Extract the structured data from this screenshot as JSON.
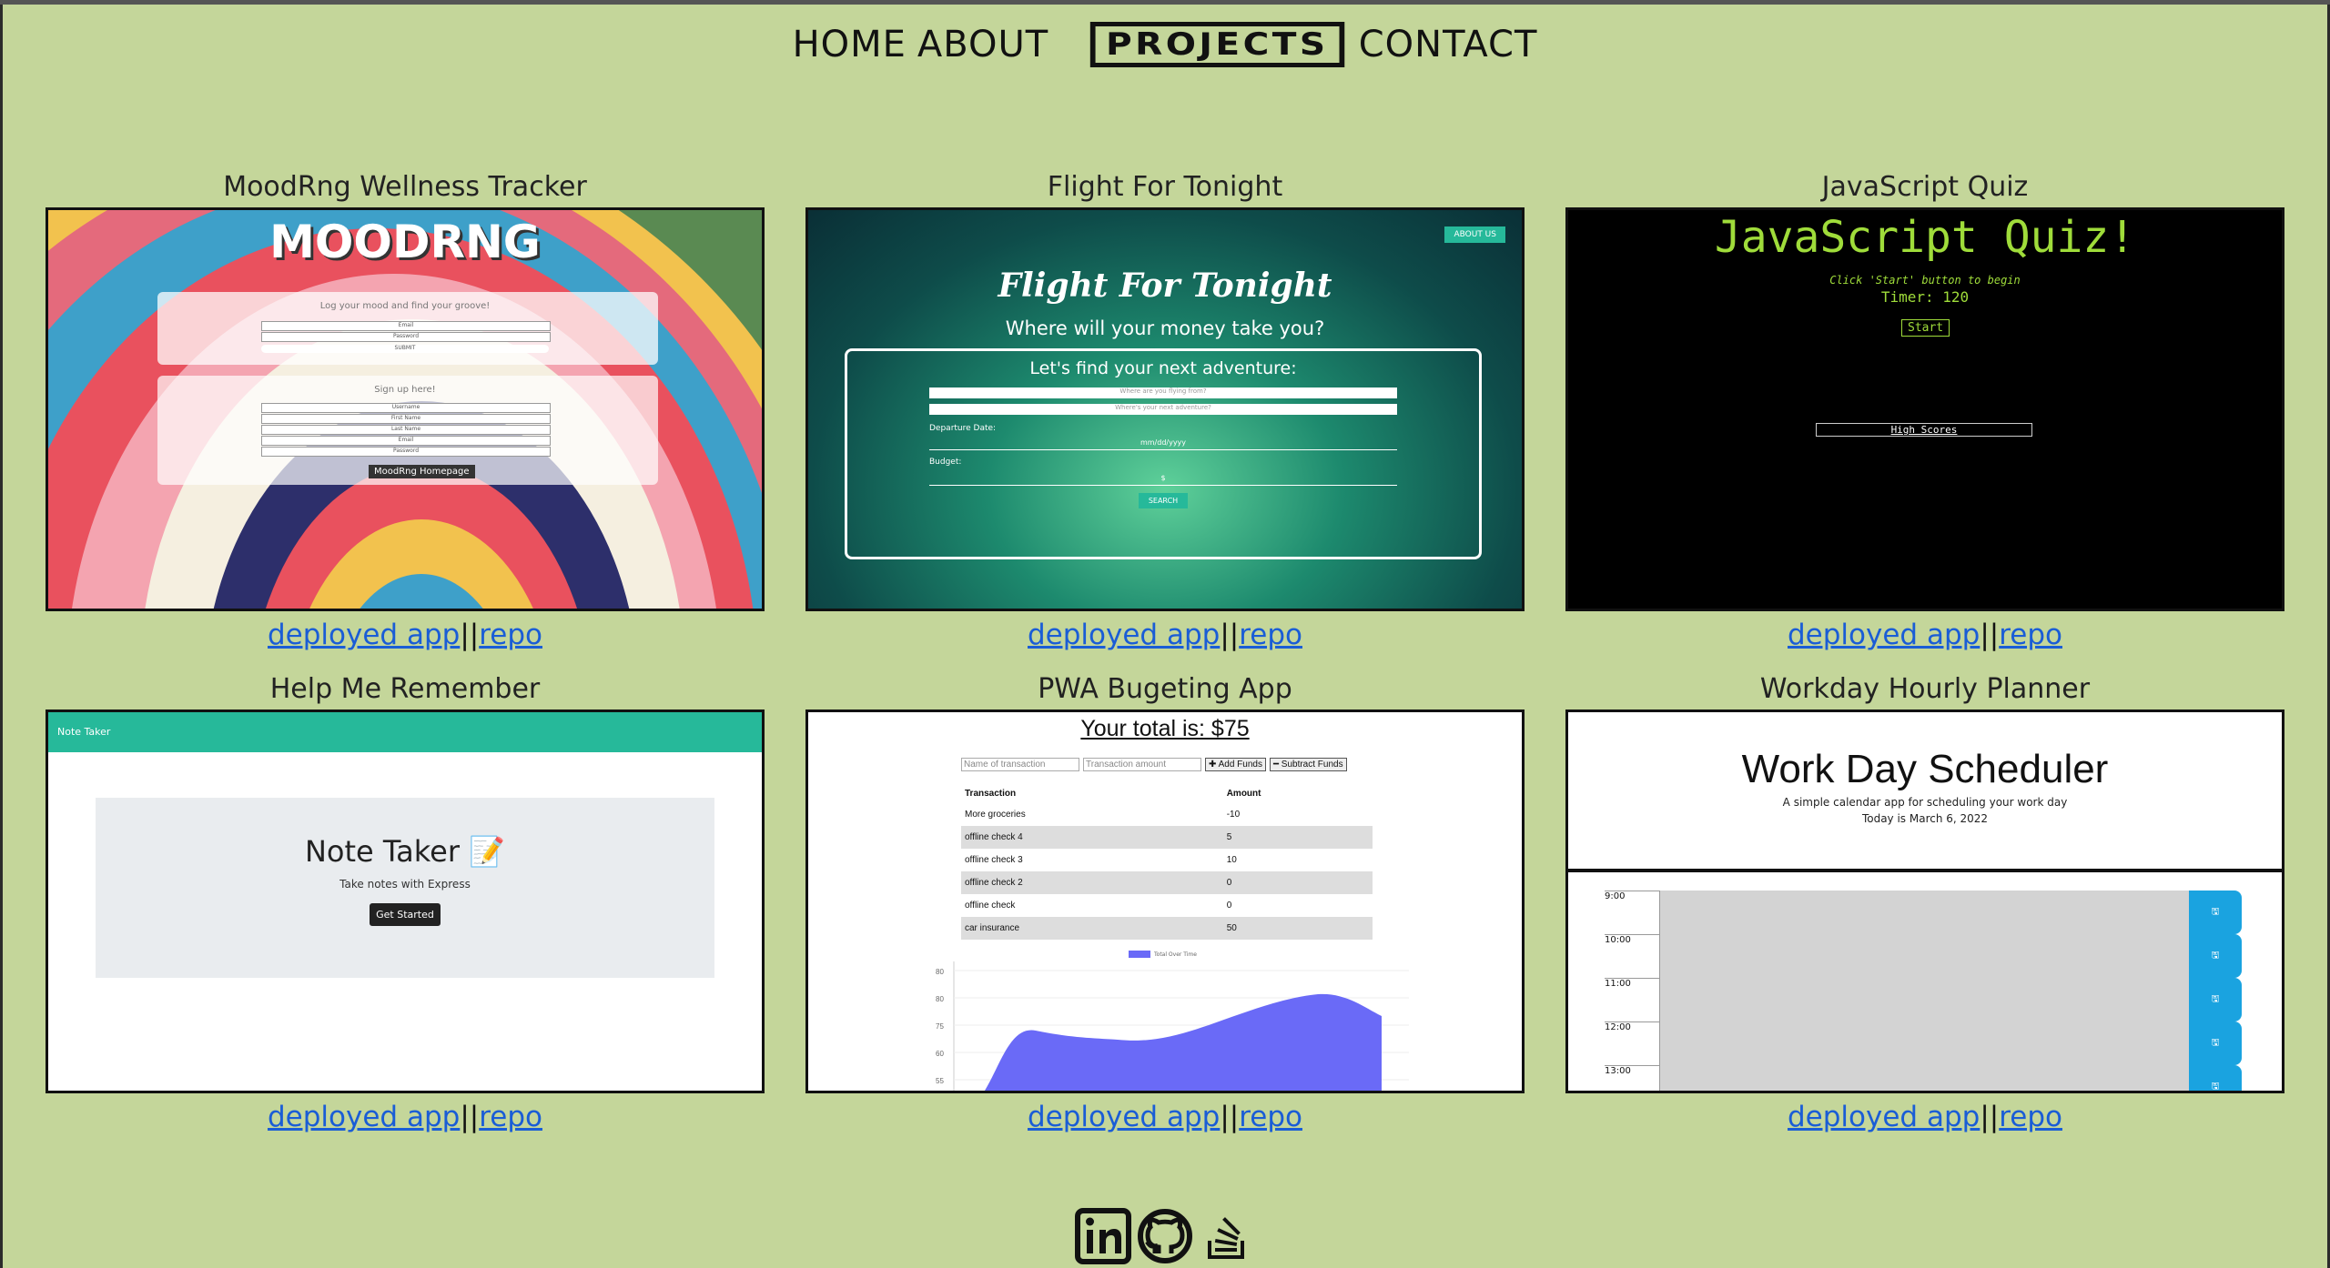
{
  "nav": {
    "items": [
      {
        "label": "HOME"
      },
      {
        "label": "ABOUT"
      },
      {
        "label": "PROJECTS",
        "active": true
      },
      {
        "label": "CONTACT"
      }
    ]
  },
  "projects": [
    {
      "title": "MoodRng Wellness Tracker",
      "deployed": "deployed app",
      "repo": "repo",
      "preview": {
        "logo": "MOODRNG",
        "login_prompt": "Log your mood and find your groove!",
        "email": "Email",
        "password": "Password",
        "submit": "SUBMIT",
        "signup_prompt": "Sign up here!",
        "username": "Username",
        "first": "First Name",
        "last": "Last Name",
        "email2": "Email",
        "password2": "Password",
        "tooltip": "MoodRng Homepage"
      }
    },
    {
      "title": "Flight For Tonight",
      "deployed": "deployed app",
      "repo": "repo",
      "preview": {
        "about": "ABOUT US",
        "heading": "Flight For Tonight",
        "sub": "Where will your money take you?",
        "box_title": "Let's find your next adventure:",
        "from": "Where are you flying from?",
        "to": "Where's your next adventure?",
        "departure": "Departure Date:",
        "date_ph": "mm/dd/yyyy",
        "budget": "Budget:",
        "dollar": "$",
        "search": "SEARCH"
      }
    },
    {
      "title": "JavaScript Quiz",
      "deployed": "deployed app",
      "repo": "repo",
      "preview": {
        "heading": "JavaScript Quiz!",
        "hint": "Click 'Start' button to begin",
        "timer": "Timer: 120",
        "start": "Start",
        "scores": "High Scores"
      }
    },
    {
      "title": "Help Me Remember",
      "deployed": "deployed app",
      "repo": "repo",
      "preview": {
        "bar": "Note Taker",
        "heading": "Note Taker 📝",
        "sub": "Take notes with Express",
        "btn": "Get Started"
      }
    },
    {
      "title": "PWA Bugeting App",
      "deployed": "deployed app",
      "repo": "repo",
      "preview": {
        "total": "Your total is: $75",
        "name_ph": "Name of transaction",
        "amount_ph": "Transaction amount",
        "add": "✚ Add Funds",
        "sub": "━ Subtract Funds",
        "col1": "Transaction",
        "col2": "Amount",
        "rows": [
          {
            "t": "More groceries",
            "a": "-10"
          },
          {
            "t": "offline check 4",
            "a": "5"
          },
          {
            "t": "offline check 3",
            "a": "10"
          },
          {
            "t": "offline check 2",
            "a": "0"
          },
          {
            "t": "offline check",
            "a": "0"
          },
          {
            "t": "car insurance",
            "a": "50"
          }
        ],
        "legend": "Total Over Time",
        "yticks": [
          "80",
          "80",
          "75",
          "60",
          "55"
        ]
      }
    },
    {
      "title": "Workday Hourly Planner",
      "deployed": "deployed app",
      "repo": "repo",
      "preview": {
        "heading": "Work Day Scheduler",
        "sub": "A simple calendar app for scheduling your work day",
        "today": "Today is March 6, 2022",
        "hours": [
          "9:00",
          "10:00",
          "11:00",
          "12:00",
          "13:00"
        ]
      }
    }
  ],
  "footer": {
    "icons": [
      "linkedin-icon",
      "github-icon",
      "stackoverflow-icon"
    ]
  },
  "colors": {
    "bg": "#c4d69a",
    "link": "#1a5dd6",
    "teal": "#26b99a",
    "chart": "#6a6af7"
  }
}
